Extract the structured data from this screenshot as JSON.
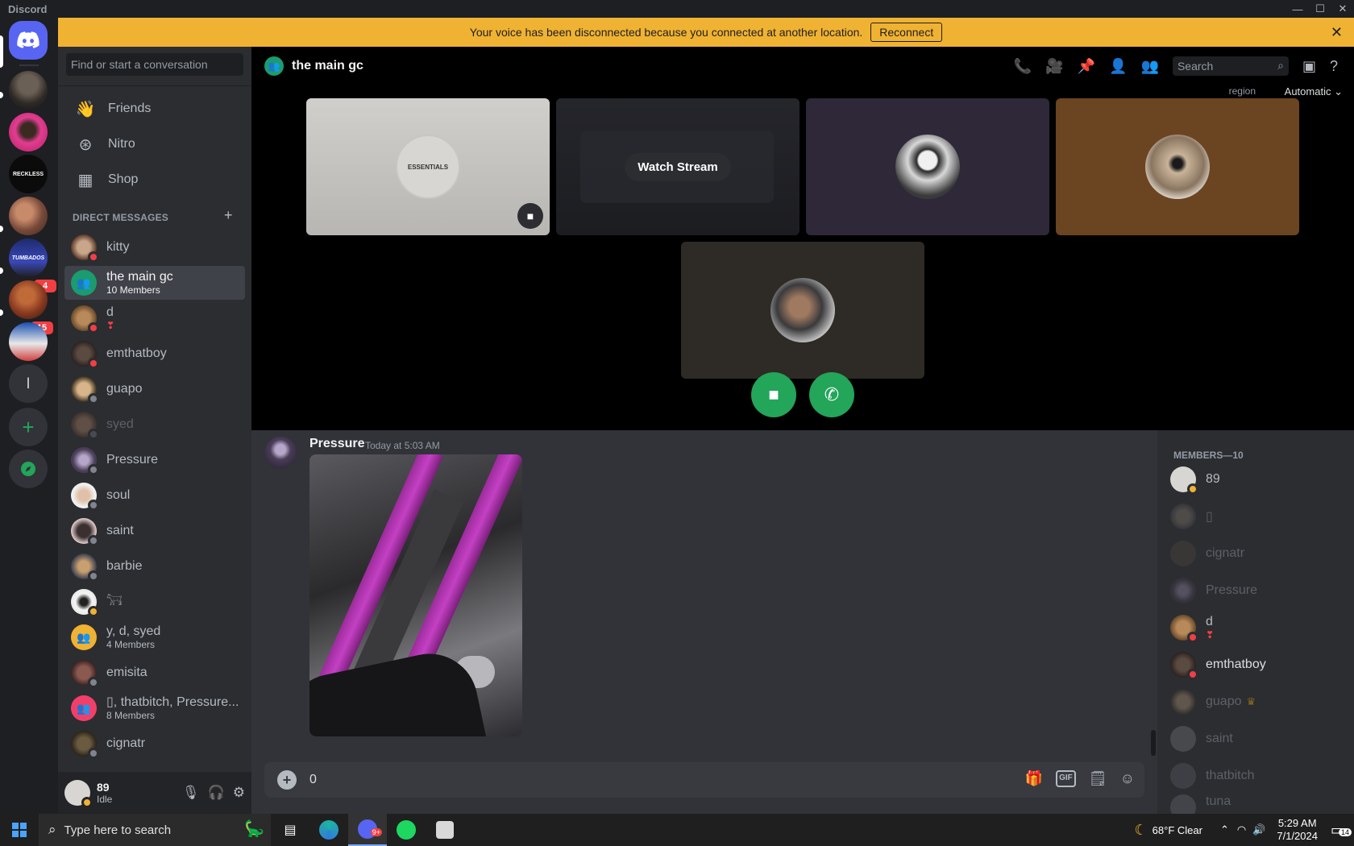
{
  "app": {
    "title": "Discord"
  },
  "window_controls": {
    "minimize": "—",
    "maximize": "☐",
    "close": "✕"
  },
  "notice": {
    "text": "Your voice has been disconnected because you connected at another location.",
    "button": "Reconnect",
    "close": "✕"
  },
  "guilds": {
    "badges": [
      "4",
      "15"
    ],
    "letter": "l",
    "add": "+",
    "reckless_label": "RECKLESS",
    "tumbados_label": "TUMBADOS"
  },
  "dm_sidebar": {
    "search_placeholder": "Find or start a conversation",
    "nav": [
      {
        "label": "Friends"
      },
      {
        "label": "Nitro"
      },
      {
        "label": "Shop"
      }
    ],
    "section_title": "DIRECT MESSAGES",
    "add": "+",
    "conversations": [
      {
        "name": "kitty",
        "sub": ""
      },
      {
        "name": "the main gc",
        "sub": "10 Members"
      },
      {
        "name": "d",
        "sub": "❣"
      },
      {
        "name": "emthatboy",
        "sub": ""
      },
      {
        "name": "guapo",
        "sub": ""
      },
      {
        "name": "syed",
        "sub": ""
      },
      {
        "name": "Pressure",
        "sub": ""
      },
      {
        "name": "soul",
        "sub": ""
      },
      {
        "name": "saint",
        "sub": ""
      },
      {
        "name": "barbie",
        "sub": ""
      },
      {
        "name": "𓃙",
        "sub": ""
      },
      {
        "name": "y, d, syed",
        "sub": "4 Members"
      },
      {
        "name": "emisita",
        "sub": ""
      },
      {
        "name": "▯, thatbitch, Pressure...",
        "sub": "8 Members"
      },
      {
        "name": "cignatr",
        "sub": ""
      }
    ]
  },
  "user_panel": {
    "name": "89",
    "status": "Idle"
  },
  "header": {
    "channel": "the main gc",
    "search_placeholder": "Search"
  },
  "call": {
    "region_label": "region",
    "region_value": "Automatic",
    "watch_stream": "Watch Stream",
    "tile1_text": "ESSENTIALS"
  },
  "message": {
    "author": "Pressure",
    "timestamp": "Today at 5:03 AM"
  },
  "composer": {
    "value": "0",
    "gif": "GIF"
  },
  "members": {
    "header": "MEMBERS—10",
    "list": [
      {
        "name": "89",
        "sub": ""
      },
      {
        "name": "▯",
        "sub": ""
      },
      {
        "name": "cignatr",
        "sub": ""
      },
      {
        "name": "Pressure",
        "sub": ""
      },
      {
        "name": "d",
        "sub": "❣"
      },
      {
        "name": "emthatboy",
        "sub": ""
      },
      {
        "name": "guapo",
        "sub": ""
      },
      {
        "name": "saint",
        "sub": ""
      },
      {
        "name": "thatbitch",
        "sub": ""
      },
      {
        "name": "tuna",
        "sub": ""
      }
    ]
  },
  "taskbar": {
    "search_placeholder": "Type here to search",
    "discord_badge": "9+",
    "weather": "68°F  Clear",
    "time": "5:29 AM",
    "date": "7/1/2024",
    "notifications": "14"
  }
}
